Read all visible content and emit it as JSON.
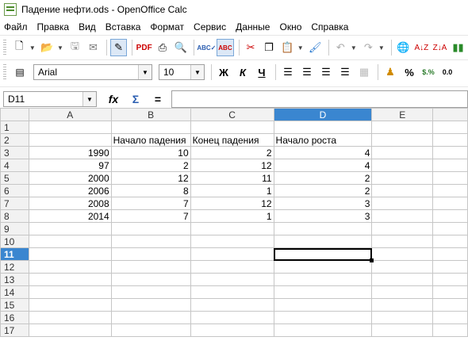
{
  "window": {
    "title": "Падение нефти.ods - OpenOffice Calc"
  },
  "menu": [
    "Файл",
    "Правка",
    "Вид",
    "Вставка",
    "Формат",
    "Сервис",
    "Данные",
    "Окно",
    "Справка"
  ],
  "toolbar": {
    "icons": [
      "new-icon",
      "open-icon",
      "save-icon",
      "email-icon",
      "edit-file-icon",
      "pdf-icon",
      "print-icon",
      "print-preview-icon",
      "spellcheck-icon",
      "autospellcheck-icon",
      "cut-icon",
      "copy-icon",
      "paste-icon",
      "clone-format-icon",
      "undo-icon",
      "redo-icon",
      "hyperlink-icon",
      "sort-ascending-icon",
      "sort-descending-icon",
      "chart-icon"
    ]
  },
  "format": {
    "font_name": "Arial",
    "font_size": "10",
    "bold": "Ж",
    "italic": "К",
    "underline": "Ч",
    "percent": "%",
    "currency": "$.%",
    "decimal": "0.0"
  },
  "formula": {
    "cell_ref": "D11",
    "fx": "fx",
    "sum": "Σ",
    "equals": "="
  },
  "sheet": {
    "columns": [
      "A",
      "B",
      "C",
      "D",
      "E"
    ],
    "active_column": "D",
    "active_row": 11,
    "rows": [
      [
        "",
        "",
        "",
        "",
        ""
      ],
      [
        "",
        "Начало падения",
        "Конец падения",
        "Начало роста",
        ""
      ],
      [
        "1990",
        "10",
        "2",
        "4",
        ""
      ],
      [
        "97",
        "2",
        "12",
        "4",
        ""
      ],
      [
        "2000",
        "12",
        "11",
        "2",
        ""
      ],
      [
        "2006",
        "8",
        "1",
        "2",
        ""
      ],
      [
        "2008",
        "7",
        "12",
        "3",
        ""
      ],
      [
        "2014",
        "7",
        "1",
        "3",
        ""
      ],
      [
        "",
        "",
        "",
        "",
        ""
      ],
      [
        "",
        "",
        "",
        "",
        ""
      ],
      [
        "",
        "",
        "",
        "",
        ""
      ],
      [
        "",
        "",
        "",
        "",
        ""
      ],
      [
        "",
        "",
        "",
        "",
        ""
      ],
      [
        "",
        "",
        "",
        "",
        ""
      ],
      [
        "",
        "",
        "",
        "",
        ""
      ],
      [
        "",
        "",
        "",
        "",
        ""
      ],
      [
        "",
        "",
        "",
        "",
        ""
      ]
    ]
  }
}
